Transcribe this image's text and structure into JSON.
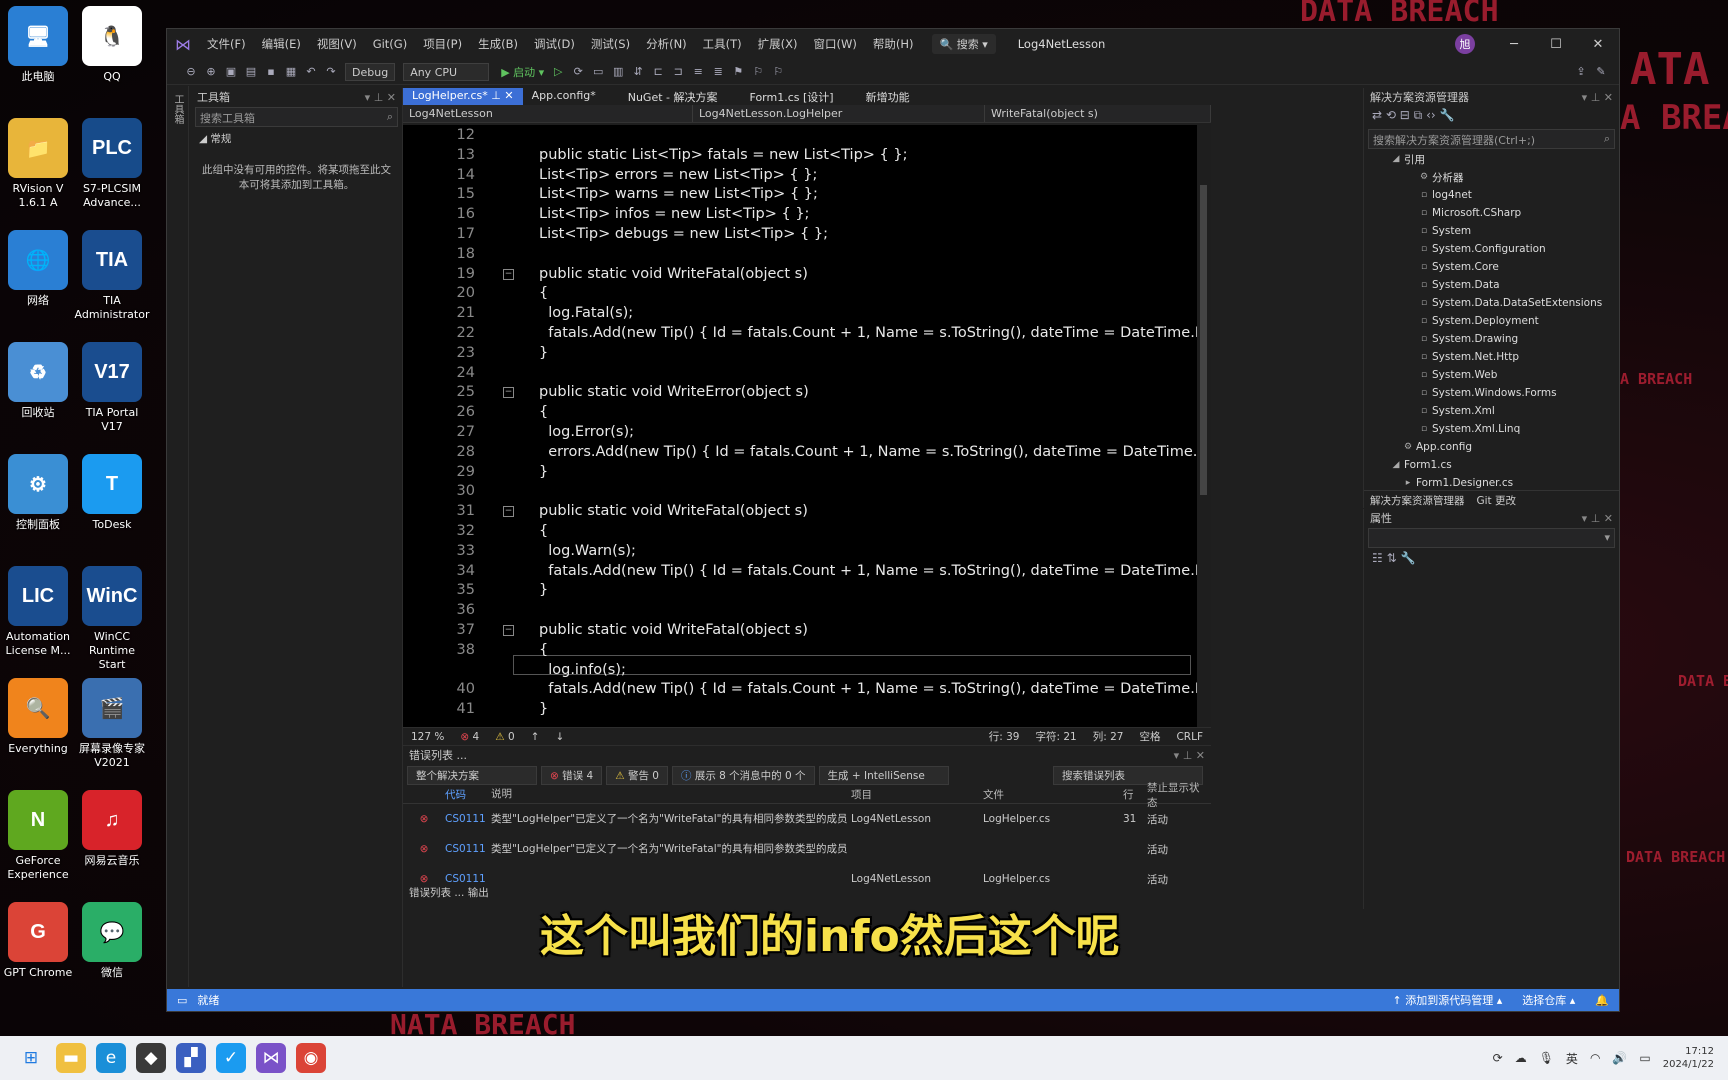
{
  "wallpaper": {
    "texts": [
      "DATA BREACH",
      "ATA",
      "A BREA",
      "A BREACH",
      "DATA B",
      "DATA BREACH",
      "NATA BREACH"
    ]
  },
  "desktop": {
    "icons": [
      {
        "label": "此电脑",
        "glyph": "🖥",
        "color": "#2a7fd4"
      },
      {
        "label": "QQ",
        "glyph": "🐧",
        "color": "#ffffff"
      },
      {
        "label": "RVision V\n1.6.1 A",
        "glyph": "📁",
        "color": "#e8b53a"
      },
      {
        "label": "S7-PLCSIM\nAdvance...",
        "glyph": "PLC",
        "color": "#174b8a"
      },
      {
        "label": "网络",
        "glyph": "🌐",
        "color": "#2a7fd4"
      },
      {
        "label": "TIA\nAdministrator",
        "glyph": "TIA",
        "color": "#1a4d8f"
      },
      {
        "label": "回收站",
        "glyph": "♻",
        "color": "#4a8fd4"
      },
      {
        "label": "TIA Portal\nV17",
        "glyph": "V17",
        "color": "#1a4d8f"
      },
      {
        "label": "控制面板",
        "glyph": "⚙",
        "color": "#3a8fd4"
      },
      {
        "label": "ToDesk",
        "glyph": "T",
        "color": "#1b9bf0"
      },
      {
        "label": "Automation\nLicense M...",
        "glyph": "LIC",
        "color": "#1a4d8f"
      },
      {
        "label": "WinCC\nRuntime Start",
        "glyph": "WinC",
        "color": "#1a4d8f"
      },
      {
        "label": "Everything",
        "glyph": "🔍",
        "color": "#f0841c"
      },
      {
        "label": "屏幕录像专家\nV2021",
        "glyph": "🎬",
        "color": "#3a6fb0"
      },
      {
        "label": "GeForce\nExperience",
        "glyph": "N",
        "color": "#5fa81f"
      },
      {
        "label": "网易云音乐",
        "glyph": "♫",
        "color": "#d8232a"
      },
      {
        "label": "GPT Chrome",
        "glyph": "G",
        "color": "#db4437"
      },
      {
        "label": "微信",
        "glyph": "💬",
        "color": "#2aae67"
      }
    ]
  },
  "vs": {
    "menu": [
      "文件(F)",
      "编辑(E)",
      "视图(V)",
      "Git(G)",
      "项目(P)",
      "生成(B)",
      "调试(D)",
      "测试(S)",
      "分析(N)",
      "工具(T)",
      "扩展(X)",
      "窗口(W)",
      "帮助(H)"
    ],
    "search": "🔍 搜索 ▾",
    "solution_name": "Log4NetLesson",
    "avatar": "旭",
    "toolbar": {
      "config": "Debug",
      "platform": "Any CPU",
      "start": "▶ 启动 ▾"
    },
    "left_strip": "工具箱",
    "toolbox": {
      "title": "工具箱",
      "search_placeholder": "搜索工具箱",
      "group": "◢ 常规",
      "empty": "此组中没有可用的控件。将某项拖至此文本可将其添加到工具箱。"
    },
    "tabs": [
      "LogHelper.cs*",
      "App.config*",
      "NuGet - 解决方案",
      "Form1.cs [设计]",
      "新增功能"
    ],
    "nav": [
      "Log4NetLesson",
      "Log4NetLesson.LogHelper",
      "WriteFatal(object s)"
    ],
    "code": [
      {
        "n": "12",
        "t": ""
      },
      {
        "n": "13",
        "t": "public static List<Tip> fatals = new List<Tip> { };"
      },
      {
        "n": "14",
        "t": "List<Tip> errors = new List<Tip> { };"
      },
      {
        "n": "15",
        "t": "List<Tip> warns = new List<Tip> { };"
      },
      {
        "n": "16",
        "t": "List<Tip> infos = new List<Tip> { };"
      },
      {
        "n": "17",
        "t": "List<Tip> debugs = new List<Tip> { };"
      },
      {
        "n": "18",
        "t": ""
      },
      {
        "n": "19",
        "t": "public static void WriteFatal(object s)"
      },
      {
        "n": "20",
        "t": "{"
      },
      {
        "n": "21",
        "t": "  log.Fatal(s);"
      },
      {
        "n": "22",
        "t": "  fatals.Add(new Tip() { Id = fatals.Count + 1, Name = s.ToString(), dateTime = DateTime.Now });"
      },
      {
        "n": "23",
        "t": "}"
      },
      {
        "n": "24",
        "t": ""
      },
      {
        "n": "25",
        "t": "public static void WriteError(object s)"
      },
      {
        "n": "26",
        "t": "{"
      },
      {
        "n": "27",
        "t": "  log.Error(s);"
      },
      {
        "n": "28",
        "t": "  errors.Add(new Tip() { Id = fatals.Count + 1, Name = s.ToString(), dateTime = DateTime.Now });"
      },
      {
        "n": "29",
        "t": "}"
      },
      {
        "n": "30",
        "t": ""
      },
      {
        "n": "31",
        "t": "public static void WriteFatal(object s)"
      },
      {
        "n": "32",
        "t": "{"
      },
      {
        "n": "33",
        "t": "  log.Warn(s);"
      },
      {
        "n": "34",
        "t": "  fatals.Add(new Tip() { Id = fatals.Count + 1, Name = s.ToString(), dateTime = DateTime.Now });"
      },
      {
        "n": "35",
        "t": "}"
      },
      {
        "n": "36",
        "t": ""
      },
      {
        "n": "37",
        "t": "public static void WriteFatal(object s)"
      },
      {
        "n": "38",
        "t": "{"
      },
      {
        "n": "",
        "t": "  log.info(s);"
      },
      {
        "n": "40",
        "t": "  fatals.Add(new Tip() { Id = fatals.Count + 1, Name = s.ToString(), dateTime = DateTime.Now });"
      },
      {
        "n": "41",
        "t": "}"
      }
    ],
    "editor_status": {
      "zoom": "127 %",
      "errors": "4",
      "warnings": "0",
      "line": "行: 39",
      "char": "字符: 21",
      "col": "列: 27",
      "spaces": "空格",
      "eol": "CRLF"
    },
    "error_list": {
      "title": "错误列表 ...",
      "scope": "整个解决方案",
      "errors": "错误 4",
      "warnings": "警告 0",
      "messages": "展示 8 个消息中的 0 个",
      "build": "生成 + IntelliSense",
      "search": "搜索错误列表",
      "headers": [
        "代码",
        "说明",
        "项目",
        "文件",
        "行",
        "禁止显示状态"
      ],
      "rows": [
        {
          "code": "CS0111",
          "desc": "类型\"LogHelper\"已定义了一个名为\"WriteFatal\"的具有相同参数类型的成员",
          "project": "Log4NetLesson",
          "file": "LogHelper.cs",
          "line": "31",
          "state": "活动"
        },
        {
          "code": "CS0111",
          "desc": "类型\"LogHelper\"已定义了一个名为\"WriteFatal\"的具有相同参数类型的成员",
          "project": "",
          "file": "",
          "line": "",
          "state": "活动"
        },
        {
          "code": "CS0111",
          "desc": "",
          "project": "Log4NetLesson",
          "file": "LogHelper.cs",
          "line": "",
          "state": "活动"
        }
      ],
      "tabs": "错误列表 ...  输出"
    },
    "solution": {
      "title": "解决方案资源管理器",
      "search": "搜索解决方案资源管理器(Ctrl+;)",
      "tree": [
        {
          "label": "引用",
          "icon": "◢",
          "indent": 24
        },
        {
          "label": "分析器",
          "icon": "⚙",
          "indent": 52
        },
        {
          "label": "log4net",
          "icon": "▫",
          "indent": 52
        },
        {
          "label": "Microsoft.CSharp",
          "icon": "▫",
          "indent": 52
        },
        {
          "label": "System",
          "icon": "▫",
          "indent": 52
        },
        {
          "label": "System.Configuration",
          "icon": "▫",
          "indent": 52
        },
        {
          "label": "System.Core",
          "icon": "▫",
          "indent": 52
        },
        {
          "label": "System.Data",
          "icon": "▫",
          "indent": 52
        },
        {
          "label": "System.Data.DataSetExtensions",
          "icon": "▫",
          "indent": 52
        },
        {
          "label": "System.Deployment",
          "icon": "▫",
          "indent": 52
        },
        {
          "label": "System.Drawing",
          "icon": "▫",
          "indent": 52
        },
        {
          "label": "System.Net.Http",
          "icon": "▫",
          "indent": 52
        },
        {
          "label": "System.Web",
          "icon": "▫",
          "indent": 52
        },
        {
          "label": "System.Windows.Forms",
          "icon": "▫",
          "indent": 52
        },
        {
          "label": "System.Xml",
          "icon": "▫",
          "indent": 52
        },
        {
          "label": "System.Xml.Linq",
          "icon": "▫",
          "indent": 52
        },
        {
          "label": "App.config",
          "icon": "⚙",
          "indent": 36
        },
        {
          "label": "Form1.cs",
          "icon": "◢",
          "indent": 24
        },
        {
          "label": "Form1.Designer.cs",
          "icon": "▸",
          "indent": 36
        }
      ],
      "tabs": [
        "解决方案资源管理器",
        "Git 更改"
      ]
    },
    "props": {
      "title": "属性"
    },
    "status": {
      "ready": "就绪",
      "source": "↑ 添加到源代码管理 ▴",
      "repo": "选择仓库 ▴"
    }
  },
  "subtitle": "这个叫我们的info然后这个呢",
  "taskbar": {
    "clock_time": "17:12",
    "clock_date": "2024/1/22",
    "ime": "英"
  }
}
